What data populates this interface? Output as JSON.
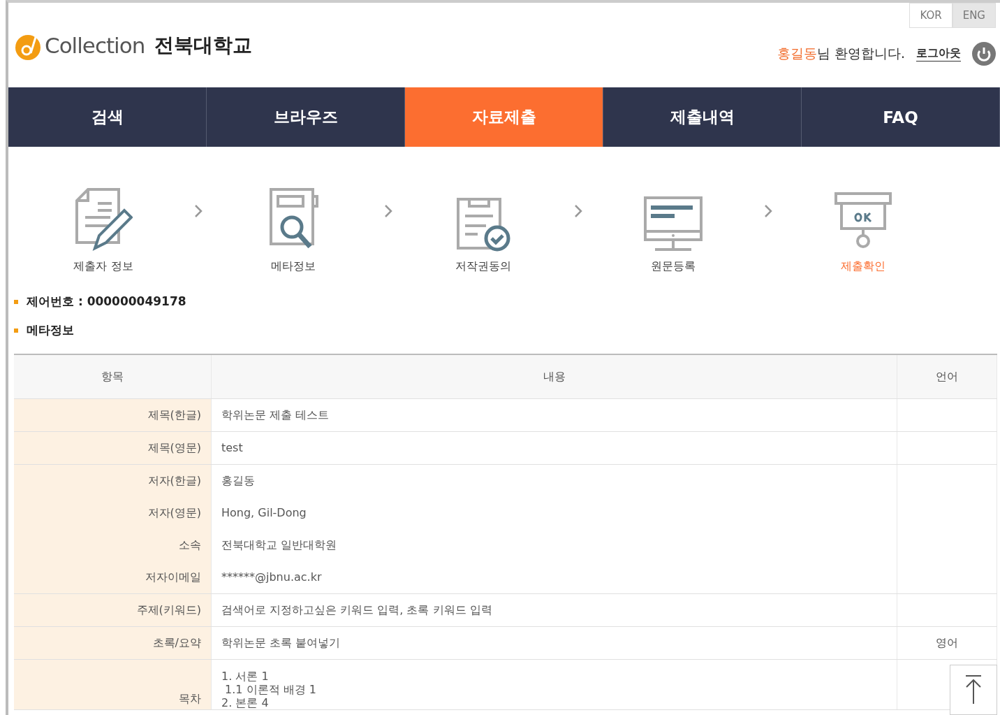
{
  "header": {
    "logo_text": "Collection",
    "university": "전북대학교",
    "languages": [
      {
        "label": "KOR",
        "selected": false
      },
      {
        "label": "ENG",
        "selected": true
      }
    ],
    "user_name": "홍길동",
    "welcome": "님 환영합니다.",
    "logout": "로그아웃"
  },
  "nav": [
    {
      "label": "검색",
      "selected": false
    },
    {
      "label": "브라우즈",
      "selected": false
    },
    {
      "label": "자료제출",
      "selected": true
    },
    {
      "label": "제출내역",
      "selected": false
    },
    {
      "label": "FAQ",
      "selected": false
    }
  ],
  "steps": [
    {
      "kind": "writer",
      "label": "제출자 정보",
      "selected": false
    },
    {
      "kind": "meta",
      "label": "메타정보",
      "selected": false
    },
    {
      "kind": "copyright",
      "label": "저작권동의",
      "selected": false
    },
    {
      "kind": "upload",
      "label": "원문등록",
      "selected": false
    },
    {
      "kind": "confirm",
      "label": "제출확인",
      "selected": true
    }
  ],
  "sections": [
    "제어번호 : 000000049178",
    "메타정보"
  ],
  "table": {
    "columns": [
      "항목",
      "내용",
      "언어"
    ],
    "rows": [
      {
        "lines": [
          {
            "label": "제목(한글)",
            "value": "학위논문 제출 테스트"
          }
        ]
      },
      {
        "lines": [
          {
            "label": "제목(영문)",
            "value": "test"
          }
        ]
      },
      {
        "lines": [
          {
            "label": "저자(한글)",
            "value": "홍길동"
          },
          {
            "label": "저자(영문)",
            "value": "Hong, Gil-Dong"
          },
          {
            "label": "소속",
            "value": "전북대학교 일반대학원"
          },
          {
            "label": "저자이메일",
            "value": "******@jbnu.ac.kr"
          }
        ]
      },
      {
        "lines": [
          {
            "label": "주제(키워드)",
            "value": "검색어로 지정하고싶은 키워드 입력, 초록 키워드 입력"
          }
        ]
      },
      {
        "lines": [
          {
            "label": "초록/요약",
            "value": "학위논문 초록 붙여넣기"
          }
        ],
        "language": "영어"
      },
      {
        "lines": [
          {
            "label": "목차",
            "value": "1. 서론 1\n 1.1 이론적 배경 1\n2. 본론 4"
          }
        ],
        "kind": "long"
      }
    ]
  }
}
